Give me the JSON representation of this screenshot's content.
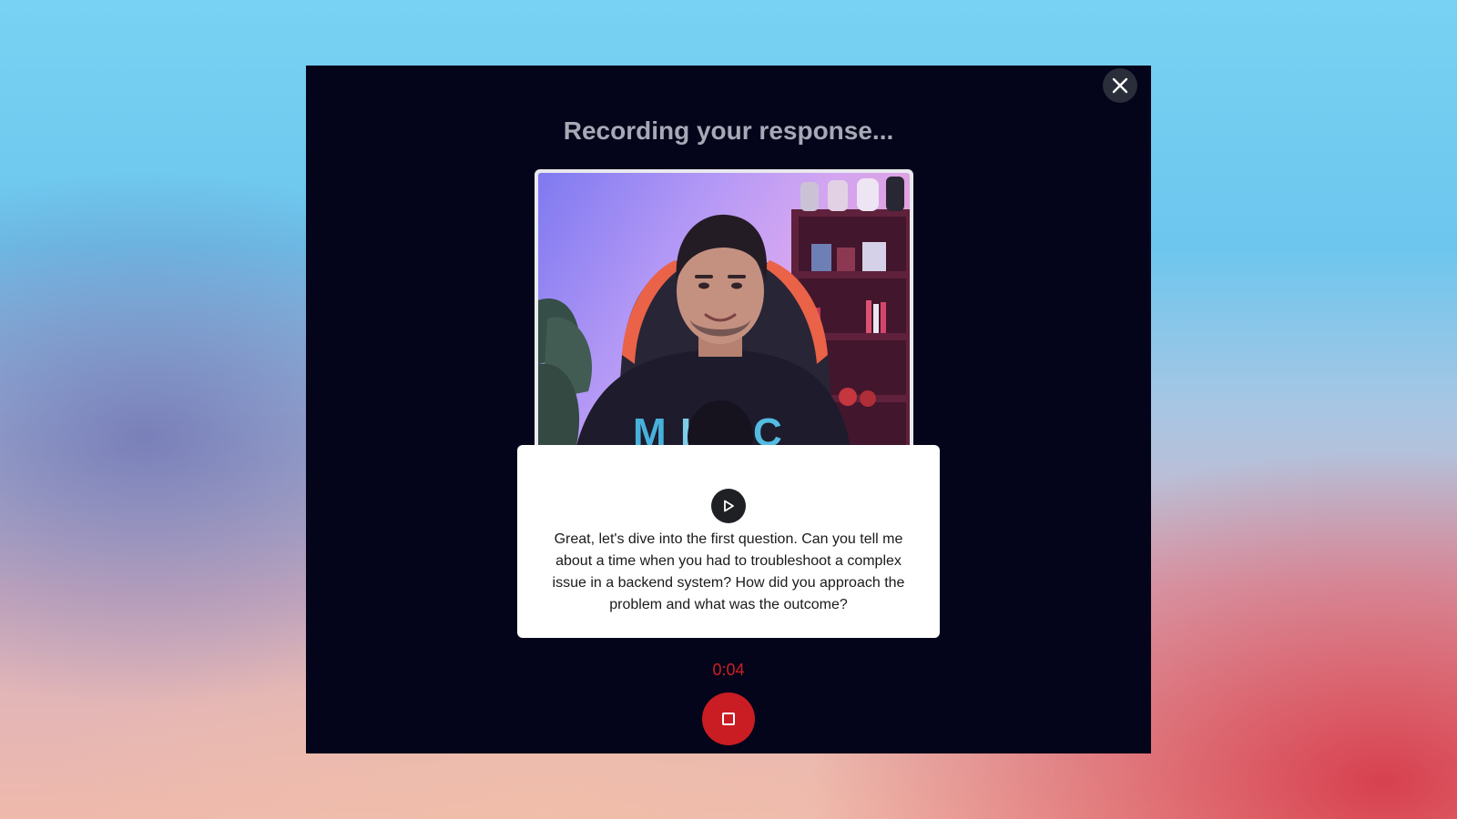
{
  "modal": {
    "title": "Recording your response...",
    "question": "Great, let's dive into the first question. Can you tell me about a time when you had to troubleshoot a complex issue in a backend system? How did you approach the problem and what was the outcome?",
    "timer": "0:04"
  },
  "icons": {
    "close": "close-icon",
    "play": "play-icon",
    "stop": "stop-icon"
  },
  "colors": {
    "modal_background": "#04051a",
    "title": "#a7a9b6",
    "timer": "#d11f25",
    "stop_button": "#c91d23"
  }
}
